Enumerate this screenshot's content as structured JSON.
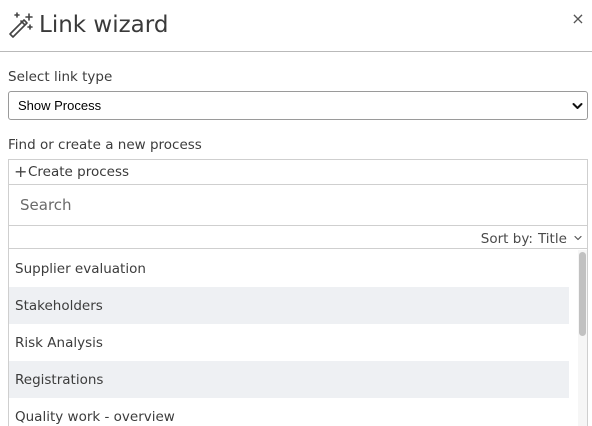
{
  "dialog": {
    "title": "Link wizard",
    "close_label": "×"
  },
  "link_type": {
    "label": "Select link type",
    "selected": "Show Process"
  },
  "find": {
    "label": "Find or create a new process",
    "create_label": "Create process",
    "search_placeholder": "Search",
    "search_value": ""
  },
  "sort": {
    "prefix": "Sort by:",
    "value": "Title"
  },
  "processes": [
    "Supplier evaluation",
    "Stakeholders",
    "Risk Analysis",
    "Registrations",
    "Quality work - overview"
  ],
  "colors": {
    "row_alt": "#eef0f3",
    "border": "#cfcfcf"
  },
  "icons": [
    "magic-wand-icon",
    "close-icon",
    "chevron-down-icon",
    "plus-icon"
  ]
}
